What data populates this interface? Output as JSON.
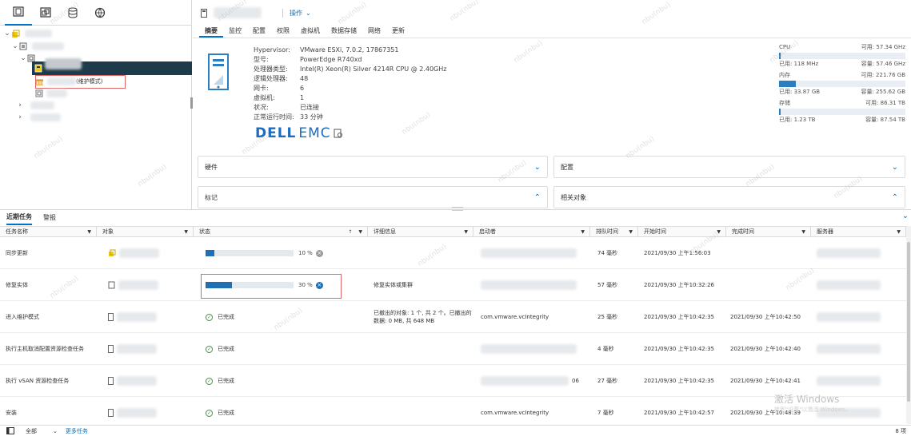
{
  "left_pane": {
    "tree_item_maintenance": "(维护模式)"
  },
  "host": {
    "actions_label": "操作",
    "tabs": [
      "摘要",
      "监控",
      "配置",
      "权限",
      "虚拟机",
      "数据存储",
      "网络",
      "更新"
    ],
    "active_tab": "摘要",
    "specs": [
      {
        "label": "Hypervisor:",
        "value": "VMware ESXi, 7.0.2, 17867351"
      },
      {
        "label": "型号:",
        "value": "PowerEdge R740xd"
      },
      {
        "label": "处理器类型:",
        "value": "Intel(R) Xeon(R) Silver 4214R CPU @ 2.40GHz"
      },
      {
        "label": "逻辑处理器:",
        "value": "48"
      },
      {
        "label": "网卡:",
        "value": "6"
      },
      {
        "label": "虚拟机:",
        "value": "1"
      },
      {
        "label": "状况:",
        "value": "已连接"
      },
      {
        "label": "正常运行时间:",
        "value": "33 分钟"
      }
    ],
    "vendor_logo_text": {
      "dell": "DELL",
      "emc": "EMC"
    },
    "resources": {
      "cpu": {
        "name": "CPU",
        "free": "可用: 57.34 GHz",
        "used": "已用: 118 MHz",
        "capacity": "容量: 57.46 GHz",
        "used_fraction": 0.002
      },
      "memory": {
        "name": "内存",
        "free": "可用: 221.76 GB",
        "used": "已用: 33.87 GB",
        "capacity": "容量: 255.62 GB",
        "used_fraction": 0.1325
      },
      "storage": {
        "name": "存储",
        "free": "可用: 86.31 TB",
        "used": "已用: 1.23 TB",
        "capacity": "容量: 87.54 TB",
        "used_fraction": 0.014
      }
    },
    "portlets": {
      "hardware": "硬件",
      "config": "配置",
      "tags": "标记",
      "related": "相关对象"
    }
  },
  "tasks_panel": {
    "tabs": [
      "近期任务",
      "警报"
    ],
    "columns": [
      "任务名称",
      "对象",
      "状态",
      "详细信息",
      "启动者",
      "排队时间",
      "开始时间",
      "完成时间",
      "服务器"
    ],
    "rows": [
      {
        "name": "同步更新",
        "status_type": "progress",
        "percent_label": "10 %",
        "progress": 0.1,
        "details": "",
        "initiator": "",
        "queued": "74 毫秒",
        "start": "2021/09/30 上午1:56:03",
        "end": ""
      },
      {
        "name": "修复实体",
        "status_type": "progress",
        "percent_label": "30 %",
        "progress": 0.3,
        "details": "修复实体或集群",
        "initiator": "",
        "queued": "57 毫秒",
        "start": "2021/09/30 上午10:32:26",
        "end": ""
      },
      {
        "name": "进入维护模式",
        "status_type": "done",
        "status_label": "已完成",
        "details": "已撤出的对象: 1 个, 共 2 个。已撤出的数据: 0 MB, 共 648 MB",
        "initiator": "com.vmware.vcIntegrity",
        "queued": "25 毫秒",
        "start": "2021/09/30 上午10:42:35",
        "end": "2021/09/30 上午10:42:50"
      },
      {
        "name": "执行主机取消配置资源检查任务",
        "status_type": "done",
        "status_label": "已完成",
        "details": "",
        "initiator": "",
        "queued": "4 毫秒",
        "start": "2021/09/30 上午10:42:35",
        "end": "2021/09/30 上午10:42:40"
      },
      {
        "name": "执行 vSAN 资源检查任务",
        "status_type": "done",
        "status_label": "已完成",
        "details": "",
        "initiator": "06",
        "queued": "27 毫秒",
        "start": "2021/09/30 上午10:42:35",
        "end": "2021/09/30 上午10:42:41"
      },
      {
        "name": "安装",
        "status_type": "done",
        "status_label": "已完成",
        "details": "",
        "initiator": "com.vmware.vcIntegrity",
        "queued": "7 毫秒",
        "start": "2021/09/30 上午10:42:57",
        "end": "2021/09/30 上午10:48:39"
      }
    ],
    "footer": {
      "filter": "全部",
      "more_tasks": "更多任务",
      "count": "8 项"
    }
  },
  "overlay": {
    "windows_activate": "激活 Windows",
    "windows_activate_sub": "转到\"设置\"以激活 Windows。"
  },
  "watermark": "nbu(nbu)"
}
